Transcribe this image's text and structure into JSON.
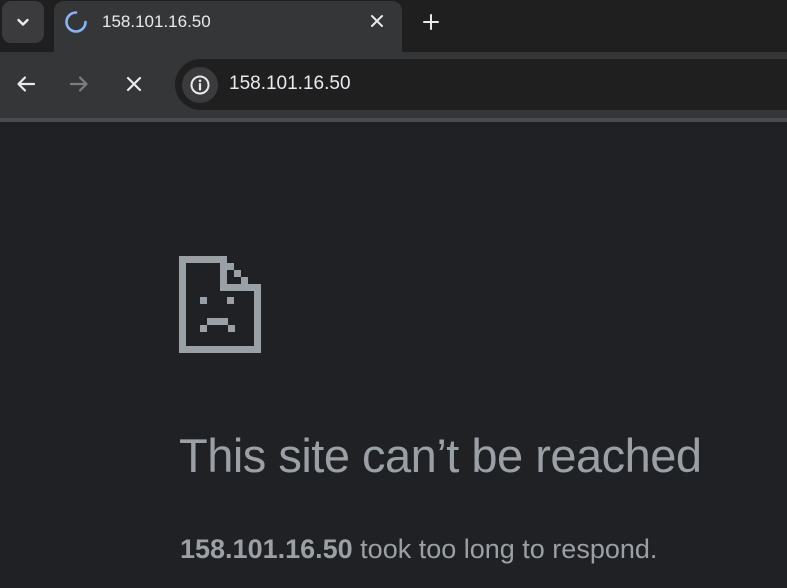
{
  "browser": {
    "tab": {
      "title": "158.101.16.50",
      "loading": true
    },
    "toolbar": {
      "url": "158.101.16.50"
    },
    "icons": {
      "tab_search": "chevron-down-icon",
      "spinner": "loading-spinner-icon",
      "tab_close": "close-icon",
      "new_tab": "plus-icon",
      "back": "arrow-left-icon",
      "forward": "arrow-right-icon",
      "stop": "close-icon",
      "site_info": "info-icon"
    },
    "colors": {
      "accent_spinner": "#8ab4f8",
      "error_text": "#9aa0a6",
      "page_background": "#202124"
    }
  },
  "error_page": {
    "icon": "sad-page-icon",
    "title": "This site can’t be reached",
    "detail_host": "158.101.16.50",
    "detail_rest": " took too long to respond."
  }
}
